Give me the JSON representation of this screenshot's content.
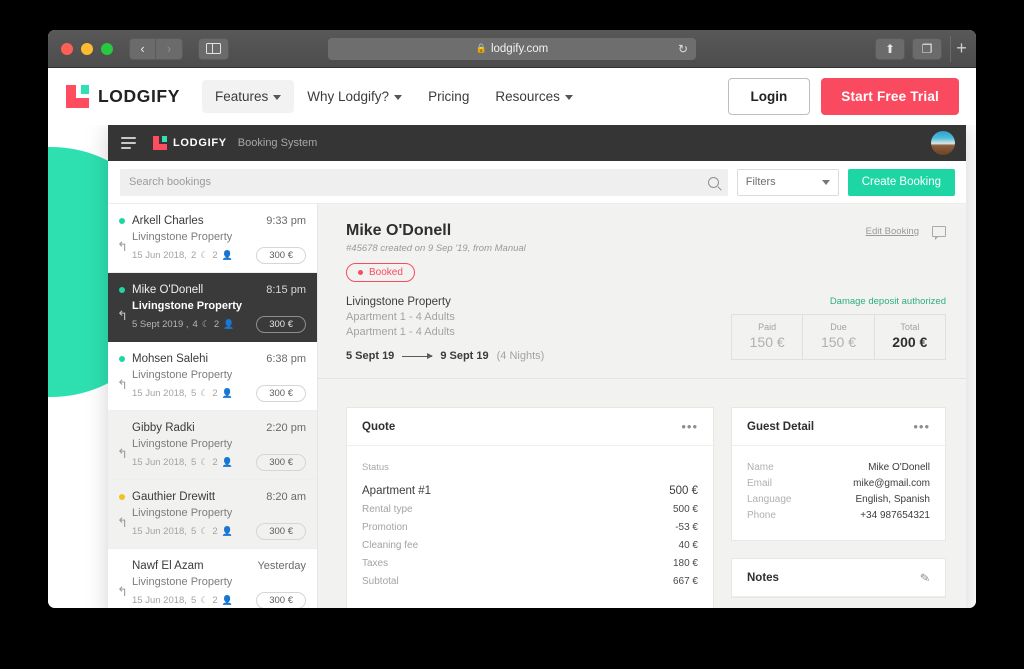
{
  "browser": {
    "url": "lodgify.com",
    "lock_icon": "lock-icon",
    "reload_icon": "↻",
    "back_icon": "‹",
    "forward_icon": "›",
    "share_icon": "⬆",
    "tabs_icon": "❐",
    "newtab_icon": "+"
  },
  "site_nav": {
    "brand": "LODGIFY",
    "links": [
      {
        "label": "Features",
        "caret": true,
        "active": true
      },
      {
        "label": "Why Lodgify?",
        "caret": true,
        "active": false
      },
      {
        "label": "Pricing",
        "caret": false,
        "active": false
      },
      {
        "label": "Resources",
        "caret": true,
        "active": false
      }
    ],
    "login_label": "Login",
    "trial_label": "Start Free Trial",
    "accent_color": "#fa4a5f"
  },
  "app": {
    "brand": "LODGIFY",
    "subtitle": "Booking System",
    "toolbar": {
      "search_placeholder": "Search bookings",
      "search_value": "",
      "filters_label": "Filters",
      "create_label": "Create Booking",
      "create_color": "#1ed6a4"
    },
    "bookings": [
      {
        "name": "Arkell Charles",
        "time": "9:33 pm",
        "property": "Livingstone Property",
        "date": "15 Jun 2018,",
        "nights": "2",
        "guests": "2",
        "price": "300 €",
        "dot": "teal",
        "state": "light"
      },
      {
        "name": "Mike O'Donell",
        "time": "8:15 pm",
        "property": "Livingstone Property",
        "date": "5 Sept 2019 ,",
        "nights": "4",
        "guests": "2",
        "price": "300 €",
        "dot": "teal",
        "state": "dark"
      },
      {
        "name": "Mohsen Salehi",
        "time": "6:38 pm",
        "property": "Livingstone Property",
        "date": "15 Jun 2018,",
        "nights": "5",
        "guests": "2",
        "price": "300 €",
        "dot": "teal",
        "state": "light"
      },
      {
        "name": "Gibby Radki",
        "time": "2:20 pm",
        "property": "Livingstone Property",
        "date": "15 Jun 2018,",
        "nights": "5",
        "guests": "2",
        "price": "300 €",
        "dot": "none",
        "state": "grey"
      },
      {
        "name": "Gauthier Drewitt",
        "time": "8:20 am",
        "property": "Livingstone Property",
        "date": "15 Jun 2018,",
        "nights": "5",
        "guests": "2",
        "price": "300 €",
        "dot": "amber",
        "state": "grey"
      },
      {
        "name": "Nawf El Azam",
        "time": "Yesterday",
        "property": "Livingstone Property",
        "date": "15 Jun 2018,",
        "nights": "5",
        "guests": "2",
        "price": "300 €",
        "dot": "none",
        "state": "light"
      }
    ],
    "detail": {
      "guest_name": "Mike O'Donell",
      "meta": "#45678 created on 9 Sep '19, from Manual",
      "status_label": "Booked",
      "status_color": "#fa4a5f",
      "edit_label": "Edit Booking",
      "property": "Livingstone Property",
      "unit_line_1": "Apartment 1 - 4 Adults",
      "unit_line_2": "Apartment 1 - 4 Adults",
      "date_from": "5 Sept 19",
      "date_to": "9 Sept 19",
      "nights_label": "(4 Nights)",
      "deposit_note": "Damage deposit authorized",
      "deposit_color": "#2fae7e",
      "totals": [
        {
          "label": "Paid",
          "value": "150 €",
          "bold": false
        },
        {
          "label": "Due",
          "value": "150 €",
          "bold": false
        },
        {
          "label": "Total",
          "value": "200 €",
          "bold": true
        }
      ]
    },
    "quote_card": {
      "title": "Quote",
      "status_label": "Status",
      "main_label": "Apartment #1",
      "main_value": "500 €",
      "rows": [
        {
          "label": "Rental type",
          "value": "500 €"
        },
        {
          "label": "Promotion",
          "value": "-53 €"
        },
        {
          "label": "Cleaning fee",
          "value": "40 €"
        },
        {
          "label": "Taxes",
          "value": "180 €"
        },
        {
          "label": "Subtotal",
          "value": "667 €"
        }
      ]
    },
    "guest_card": {
      "title": "Guest Detail",
      "rows": [
        {
          "label": "Name",
          "value": "Mike O'Donell"
        },
        {
          "label": "Email",
          "value": "mike@gmail.com"
        },
        {
          "label": "Language",
          "value": "English, Spanish"
        },
        {
          "label": "Phone",
          "value": "+34 987654321"
        }
      ]
    },
    "notes_card": {
      "title": "Notes"
    }
  }
}
